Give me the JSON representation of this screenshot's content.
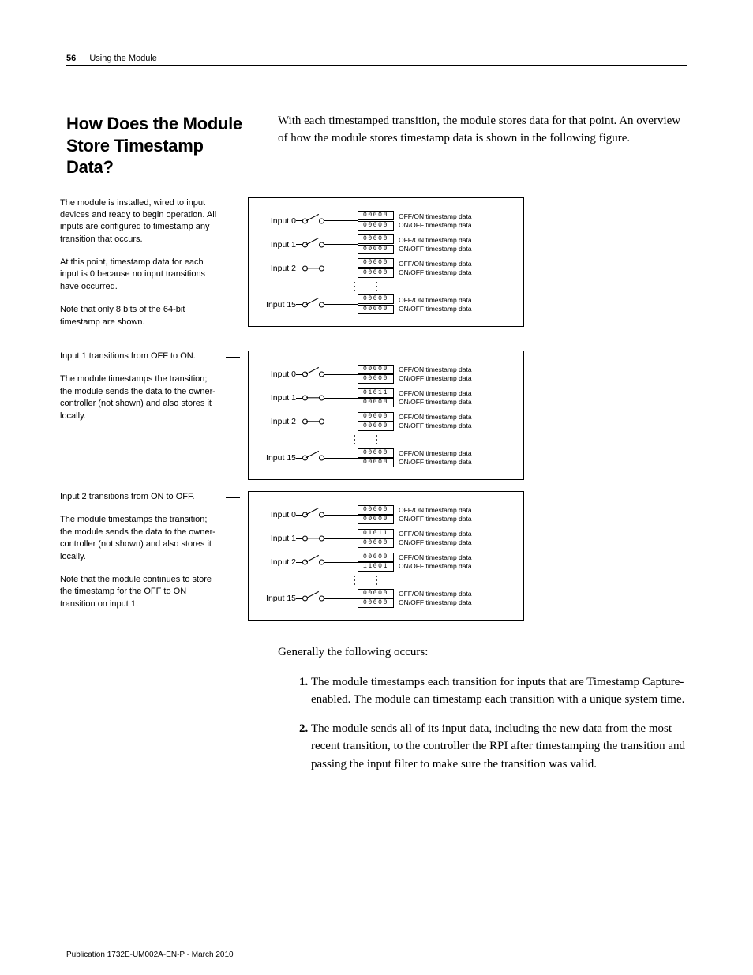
{
  "header": {
    "page_number": "56",
    "running_title": "Using the Module"
  },
  "section": {
    "title": "How Does the Module Store Timestamp Data?",
    "intro": "With each timestamped transition, the module stores data for that point. An overview of how the module stores timestamp data is shown in the following figure."
  },
  "figures": [
    {
      "caption": [
        "The module is installed, wired to input devices and ready to begin operation. All inputs are configured to timestamp any transition that occurs.",
        "At this point, timestamp data for each input is 0 because no input transitions have occurred.",
        "Note that only 8 bits of the 64-bit timestamp are shown."
      ],
      "rows": [
        {
          "label": "Input 0",
          "sw": "open",
          "regA": "00000",
          "regB": "00000"
        },
        {
          "label": "Input 1",
          "sw": "open",
          "regA": "00000",
          "regB": "00000"
        },
        {
          "label": "Input 2",
          "sw": "closed",
          "regA": "00000",
          "regB": "00000"
        },
        {
          "label": "Input 15",
          "sw": "open",
          "regA": "00000",
          "regB": "00000"
        }
      ]
    },
    {
      "caption": [
        "Input 1 transitions from OFF to ON.",
        "The module timestamps the transition; the module sends the data to the owner-controller (not shown) and also stores it locally."
      ],
      "rows": [
        {
          "label": "Input 0",
          "sw": "open",
          "regA": "00000",
          "regB": "00000"
        },
        {
          "label": "Input 1",
          "sw": "closed",
          "regA": "01011",
          "regB": "00000"
        },
        {
          "label": "Input 2",
          "sw": "closed",
          "regA": "00000",
          "regB": "00000"
        },
        {
          "label": "Input 15",
          "sw": "open",
          "regA": "00000",
          "regB": "00000"
        }
      ]
    },
    {
      "caption": [
        "Input 2 transitions from ON to OFF.",
        "The module timestamps the transition; the module sends the data to the owner-controller (not shown) and also stores it locally.",
        "Note that the module continues to store the timestamp for the OFF to ON transition on input 1."
      ],
      "rows": [
        {
          "label": "Input 0",
          "sw": "open",
          "regA": "00000",
          "regB": "00000"
        },
        {
          "label": "Input 1",
          "sw": "closed",
          "regA": "01011",
          "regB": "00000"
        },
        {
          "label": "Input 2",
          "sw": "open",
          "regA": "00000",
          "regB": "11001"
        },
        {
          "label": "Input 15",
          "sw": "open",
          "regA": "00000",
          "regB": "00000"
        }
      ]
    }
  ],
  "labels": {
    "off_on": "OFF/ON timestamp data",
    "on_off": "ON/OFF timestamp data"
  },
  "post_figure_lead": "Generally the following occurs:",
  "steps": [
    "The module timestamps each transition for inputs that are Timestamp Capture-enabled. The module can timestamp each transition with a unique system time.",
    "The module sends all of its input data, including the new data from the most recent transition, to the controller the RPI after timestamping the transition and passing the input filter to make sure the transition was valid."
  ],
  "footer": "Publication 1732E-UM002A-EN-P - March 2010"
}
